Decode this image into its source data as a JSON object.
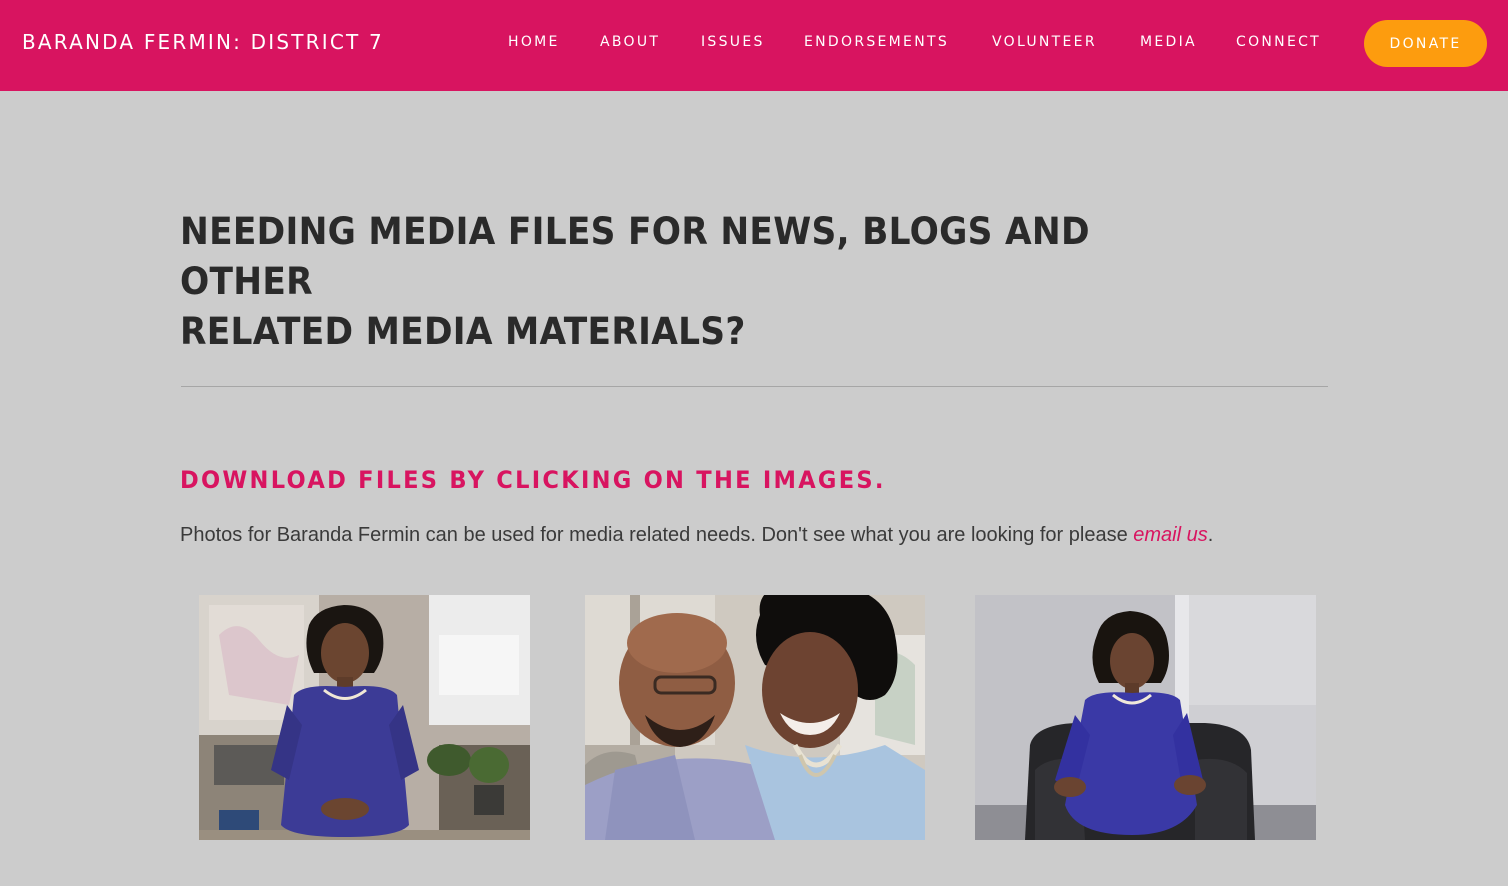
{
  "header": {
    "site_title": "BARANDA FERMIN: DISTRICT 7",
    "nav": [
      "HOME",
      "ABOUT",
      "ISSUES",
      "ENDORSEMENTS",
      "VOLUNTEER",
      "MEDIA",
      "CONNECT"
    ],
    "donate_label": "DONATE",
    "colors": {
      "brand": "#d81460",
      "donate": "#fd9c0e"
    }
  },
  "main": {
    "headline_line1": "NEEDING MEDIA FILES FOR NEWS, BLOGS AND OTHER",
    "headline_line2": "RELATED MEDIA MATERIALS?",
    "subhead": "DOWNLOAD FILES BY CLICKING ON THE IMAGES.",
    "intro_text": "Photos for Baranda Fermin can be used for media related needs. Don't see what you are looking for please ",
    "intro_link": "email us",
    "intro_end": "."
  },
  "photos": [
    "portrait-seated-office",
    "couple-portrait",
    "portrait-armchair"
  ]
}
